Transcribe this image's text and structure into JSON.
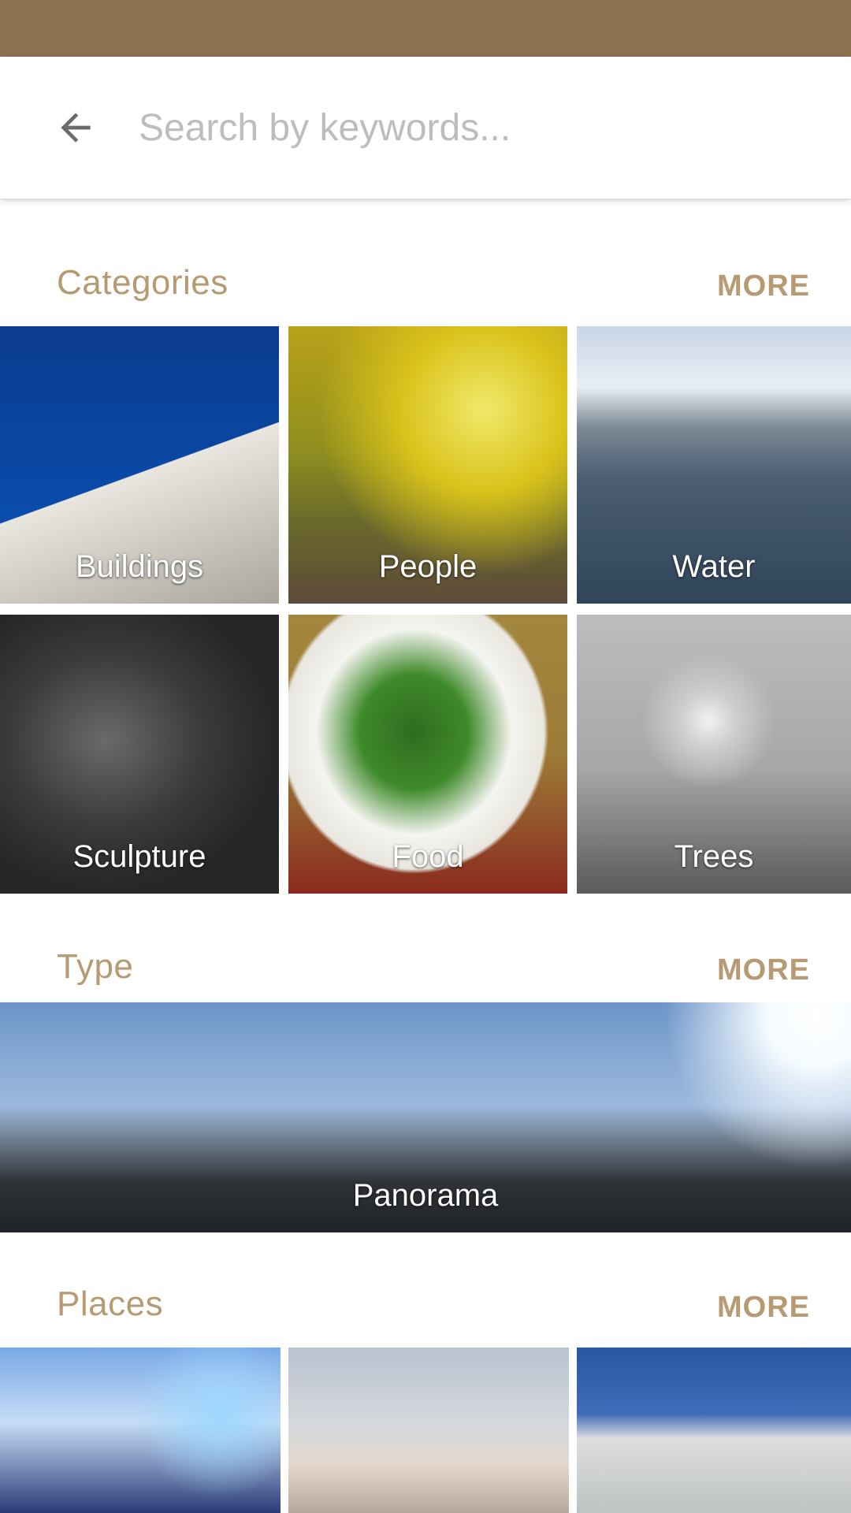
{
  "search": {
    "placeholder": "Search by keywords..."
  },
  "icons": {
    "back": "arrow-back-icon"
  },
  "colors": {
    "status_bar": "#8b7150",
    "accent": "#b59a72"
  },
  "sections": {
    "categories": {
      "title": "Categories",
      "more": "MORE",
      "tiles": [
        {
          "label": "Buildings"
        },
        {
          "label": "People"
        },
        {
          "label": "Water"
        },
        {
          "label": "Sculpture"
        },
        {
          "label": "Food"
        },
        {
          "label": "Trees"
        }
      ]
    },
    "type": {
      "title": "Type",
      "more": "MORE",
      "tiles": [
        {
          "label": "Panorama"
        }
      ]
    },
    "places": {
      "title": "Places",
      "more": "MORE"
    }
  }
}
